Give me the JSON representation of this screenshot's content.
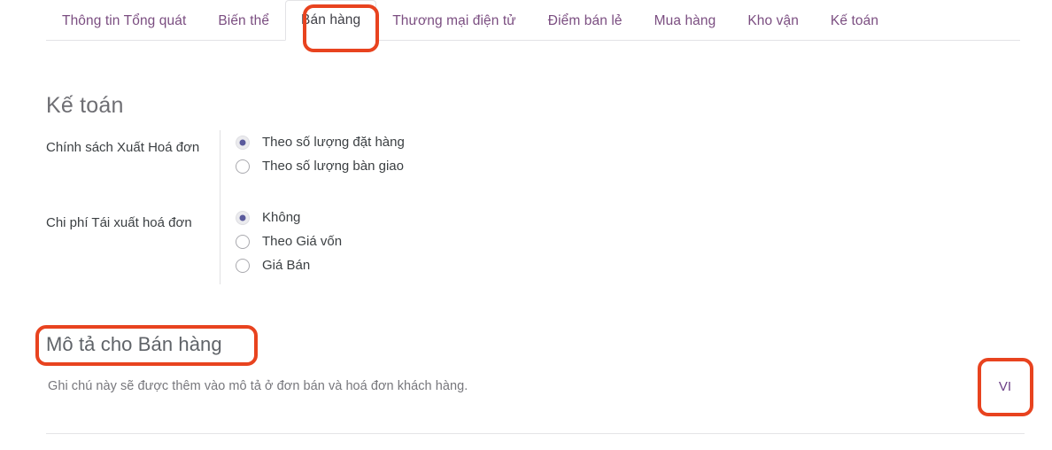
{
  "tabs": [
    {
      "label": "Thông tin Tổng quát",
      "active": false
    },
    {
      "label": "Biến thể",
      "active": false
    },
    {
      "label": "Bán hàng",
      "active": true
    },
    {
      "label": "Thương mại điện tử",
      "active": false
    },
    {
      "label": "Điểm bán lẻ",
      "active": false
    },
    {
      "label": "Mua hàng",
      "active": false
    },
    {
      "label": "Kho vận",
      "active": false
    },
    {
      "label": "Kế toán",
      "active": false
    }
  ],
  "accounting": {
    "section_title": "Kế toán",
    "fields": [
      {
        "label": "Chính sách Xuất Hoá đơn",
        "options": [
          {
            "label": "Theo số lượng đặt hàng",
            "checked": true
          },
          {
            "label": "Theo số lượng bàn giao",
            "checked": false
          }
        ]
      },
      {
        "label": "Chi phí Tái xuất hoá đơn",
        "options": [
          {
            "label": "Không",
            "checked": true
          },
          {
            "label": "Theo Giá vốn",
            "checked": false
          },
          {
            "label": "Giá Bán",
            "checked": false
          }
        ]
      }
    ]
  },
  "description": {
    "title": "Mô tả cho Bán hàng",
    "help_text": "Ghi chú này sẽ được thêm vào mô tả ở đơn bán và hoá đơn khách hàng."
  },
  "language_badge": {
    "label": "VI"
  },
  "annotations": {
    "accent_color": "#e8431f",
    "targets": [
      "tab-ban-hang",
      "description-title",
      "language-badge"
    ]
  }
}
